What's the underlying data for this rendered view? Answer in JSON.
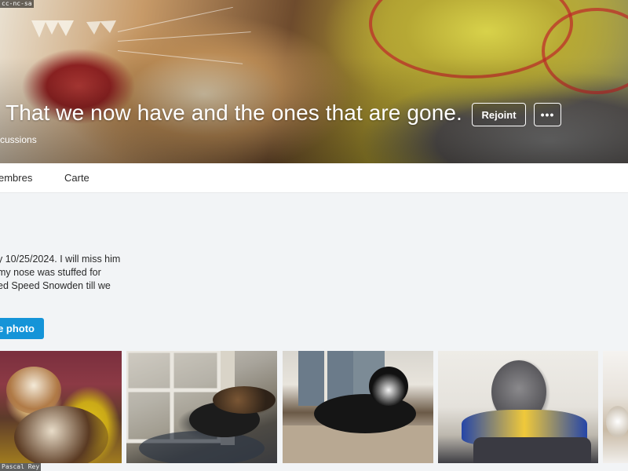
{
  "watermark": {
    "license": "cc-nc-sa",
    "photo_credit": "Pascal Rey"
  },
  "header": {
    "title": "That we now have and the ones that are gone.",
    "subtitle": "cussions",
    "rejoin_label": "Rejoint",
    "more_label": "•••",
    "more_icon": "more-horizontal-icon"
  },
  "tabs": [
    {
      "label": "embres"
    },
    {
      "label": "Carte"
    }
  ],
  "description": {
    "lines": [
      "y 10/25/2024. I will miss him",
      " my nose was stuffed for",
      "ed Speed Snowden till we"
    ]
  },
  "add_photo_label": "e photo",
  "colors": {
    "accent": "#1594d8",
    "page_bg": "#f2f4f6",
    "tab_bar_bg": "#ffffff",
    "text_primary": "#2a2a2a"
  },
  "photos": [
    {
      "subject": "long-haired calico cat on yellow blanket"
    },
    {
      "subject": "two cats by a window"
    },
    {
      "subject": "tuxedo cat lying on a chair"
    },
    {
      "subject": "grey cat in a blue basket"
    },
    {
      "subject": "cat partially visible"
    }
  ]
}
